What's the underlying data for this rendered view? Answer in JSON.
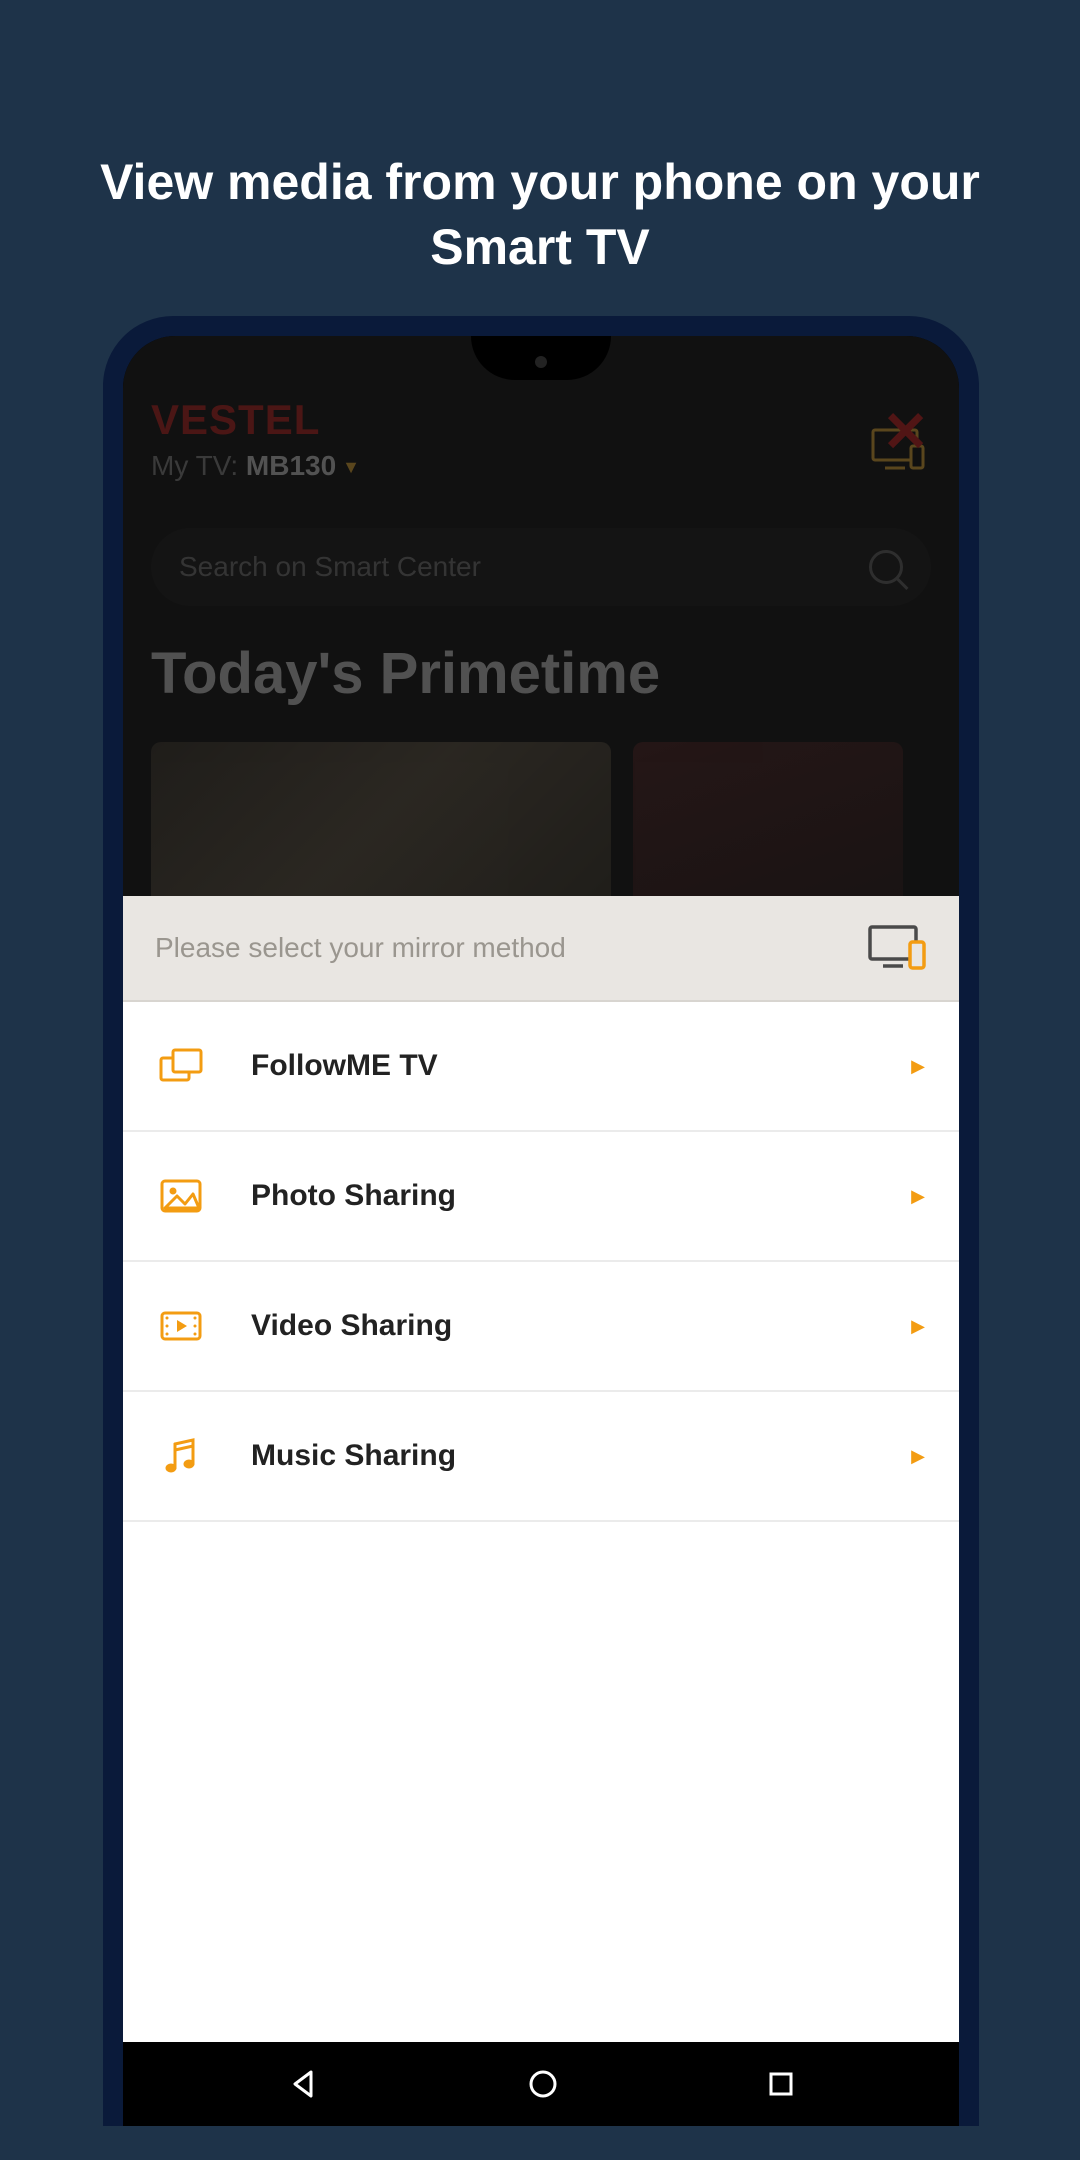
{
  "promo": {
    "headline": "View media from your phone on your Smart TV"
  },
  "app": {
    "brand": "VESTEL",
    "tv_label_prefix": "My TV: ",
    "tv_name": "MB130",
    "search_placeholder": "Search on Smart Center",
    "section_title": "Today's Primetime"
  },
  "sheet": {
    "title": "Please select your mirror method",
    "items": [
      {
        "label": "FollowME TV",
        "icon": "screens-icon"
      },
      {
        "label": "Photo Sharing",
        "icon": "photo-icon"
      },
      {
        "label": "Video Sharing",
        "icon": "video-icon"
      },
      {
        "label": "Music Sharing",
        "icon": "music-icon"
      }
    ]
  },
  "colors": {
    "accent": "#f39c12",
    "close": "#c81e1e"
  }
}
